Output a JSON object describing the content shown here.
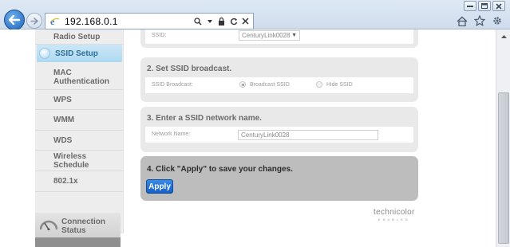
{
  "browser": {
    "address": "192.168.0.1",
    "icons": [
      "back-arrow-icon",
      "forward-arrow-icon",
      "ie-logo-icon",
      "search-icon",
      "dropdown-icon",
      "lock-icon",
      "refresh-icon",
      "close-icon",
      "home-icon",
      "star-icon",
      "gear-icon",
      "minimize-icon",
      "maximize-icon",
      "window-close-icon"
    ]
  },
  "sidebar": {
    "items": [
      {
        "label": "Radio Setup",
        "active": false
      },
      {
        "label": "SSID Setup",
        "active": true
      },
      {
        "label": "MAC Authentication",
        "active": false
      },
      {
        "label": "WPS",
        "active": false
      },
      {
        "label": "WMM",
        "active": false
      },
      {
        "label": "WDS",
        "active": false
      },
      {
        "label": "Wireless Schedule",
        "active": false
      },
      {
        "label": "802.1x",
        "active": false
      }
    ],
    "connection_status": "Connection Status"
  },
  "sections": {
    "ssid": {
      "label": "SSID:",
      "selected": "CenturyLink0028"
    },
    "broadcast": {
      "title": "2. Set SSID broadcast.",
      "label": "SSID Broadcast:",
      "option_broadcast": "Broadcast SSID",
      "option_hide": "Hide SSID",
      "selected": "Broadcast SSID"
    },
    "network_name": {
      "title": "3. Enter a SSID network name.",
      "label": "Network Name:",
      "value": "CenturyLink0028"
    },
    "apply": {
      "title": "4. Click \"Apply\" to save your changes.",
      "button": "Apply"
    }
  },
  "brand": {
    "name": "technicolor",
    "tagline": "ENABLED"
  },
  "colors": {
    "accent": "#1560c8",
    "active_nav": "#aed9f1",
    "section_bg": "#e9e9e9",
    "apply_bg": "#bdbdbd"
  }
}
